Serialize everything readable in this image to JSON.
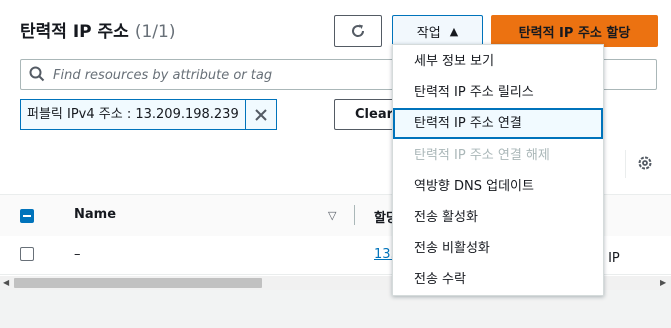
{
  "header": {
    "title": "탄력적 IP 주소",
    "count": "(1/1)",
    "actions_label": "작업",
    "allocate_label": "탄력적 IP 주소 할당",
    "refresh_icon": "refresh-icon"
  },
  "search": {
    "placeholder": "Find resources by attribute or tag"
  },
  "filter": {
    "token_label": "퍼블릭 IPv4 주소 : 13.209.198.239",
    "clear_label": "Clear"
  },
  "table": {
    "header_name": "Name",
    "header_col2": "할당",
    "rows": [
      {
        "name": "–",
        "ip": "13.",
        "type": "릭 IP"
      }
    ]
  },
  "actions_menu": {
    "items": [
      {
        "label": "세부 정보 보기",
        "disabled": false
      },
      {
        "label": "탄력적 IP 주소 릴리스",
        "disabled": false
      },
      {
        "label": "탄력적 IP 주소 연결",
        "disabled": false,
        "focused": true
      },
      {
        "label": "탄력적 IP 주소 연결 해제",
        "disabled": true
      },
      {
        "label": "역방향 DNS 업데이트",
        "disabled": false
      },
      {
        "label": "전송 활성화",
        "disabled": false
      },
      {
        "label": "전송 비활성화",
        "disabled": false
      },
      {
        "label": "전송 수락",
        "disabled": false
      }
    ]
  },
  "colors": {
    "primary": "#ec7211",
    "link": "#0073bb",
    "disabled": "#aab7b8"
  }
}
